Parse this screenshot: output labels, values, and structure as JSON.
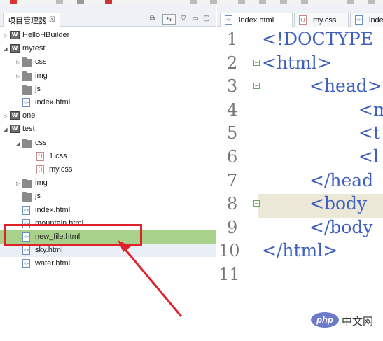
{
  "explorer": {
    "tab_label": "项目管理器",
    "tab_close": "☒",
    "tree": [
      {
        "label": "HelloHBuilder",
        "type": "project",
        "depth": 0,
        "arrow": "▷"
      },
      {
        "label": "mytest",
        "type": "project",
        "depth": 0,
        "arrow": "◢"
      },
      {
        "label": "css",
        "type": "folder",
        "depth": 1,
        "arrow": "▷"
      },
      {
        "label": "img",
        "type": "folder",
        "depth": 1,
        "arrow": "▷"
      },
      {
        "label": "js",
        "type": "folder",
        "depth": 1,
        "arrow": ""
      },
      {
        "label": "index.html",
        "type": "html",
        "depth": 1,
        "arrow": ""
      },
      {
        "label": "one",
        "type": "project",
        "depth": 0,
        "arrow": "▷"
      },
      {
        "label": "test",
        "type": "project",
        "depth": 0,
        "arrow": "◢"
      },
      {
        "label": "css",
        "type": "folder",
        "depth": 1,
        "arrow": "◢"
      },
      {
        "label": "1.css",
        "type": "css",
        "depth": 2,
        "arrow": ""
      },
      {
        "label": "my.css",
        "type": "css",
        "depth": 2,
        "arrow": ""
      },
      {
        "label": "img",
        "type": "folder",
        "depth": 1,
        "arrow": "▷"
      },
      {
        "label": "js",
        "type": "folder",
        "depth": 1,
        "arrow": ""
      },
      {
        "label": "index.html",
        "type": "html",
        "depth": 1,
        "arrow": ""
      },
      {
        "label": "mountain.html",
        "type": "html",
        "depth": 1,
        "arrow": ""
      },
      {
        "label": "new_file.html",
        "type": "html",
        "depth": 1,
        "arrow": "",
        "selected": true
      },
      {
        "label": "sky.html",
        "type": "html",
        "depth": 1,
        "arrow": "",
        "hover": true
      },
      {
        "label": "water.html",
        "type": "html",
        "depth": 1,
        "arrow": ""
      }
    ]
  },
  "editor": {
    "tabs": [
      {
        "label": "index.html",
        "icon": "html"
      },
      {
        "label": "my.css",
        "icon": "css"
      },
      {
        "label": "inde",
        "icon": "html"
      }
    ],
    "lines": [
      {
        "num": "1",
        "code": "<!DOCTYPE",
        "indent": 0,
        "fold": false
      },
      {
        "num": "2",
        "code": "<html>",
        "indent": 0,
        "fold": true
      },
      {
        "num": "3",
        "code": "<head>",
        "indent": 1,
        "fold": true
      },
      {
        "num": "4",
        "code": "<m",
        "indent": 2,
        "fold": false
      },
      {
        "num": "5",
        "code": "<t",
        "indent": 2,
        "fold": false
      },
      {
        "num": "6",
        "code": "<l",
        "indent": 2,
        "fold": false
      },
      {
        "num": "7",
        "code": "</head",
        "indent": 1,
        "fold": false
      },
      {
        "num": "8",
        "code": "<body",
        "indent": 1,
        "fold": true
      },
      {
        "num": "9",
        "code": "</body",
        "indent": 1,
        "fold": false
      },
      {
        "num": "10",
        "code": "</html>",
        "indent": 0,
        "fold": false
      },
      {
        "num": "11",
        "code": "",
        "indent": 0,
        "fold": false
      }
    ],
    "current_line": "8"
  },
  "watermark": {
    "logo": "php",
    "text": "中文网"
  },
  "colors": {
    "selected_row": "#a8d28b",
    "highlight": "#e0222a",
    "tag": "#3f5fbf",
    "current_line": "#ece8d8"
  }
}
